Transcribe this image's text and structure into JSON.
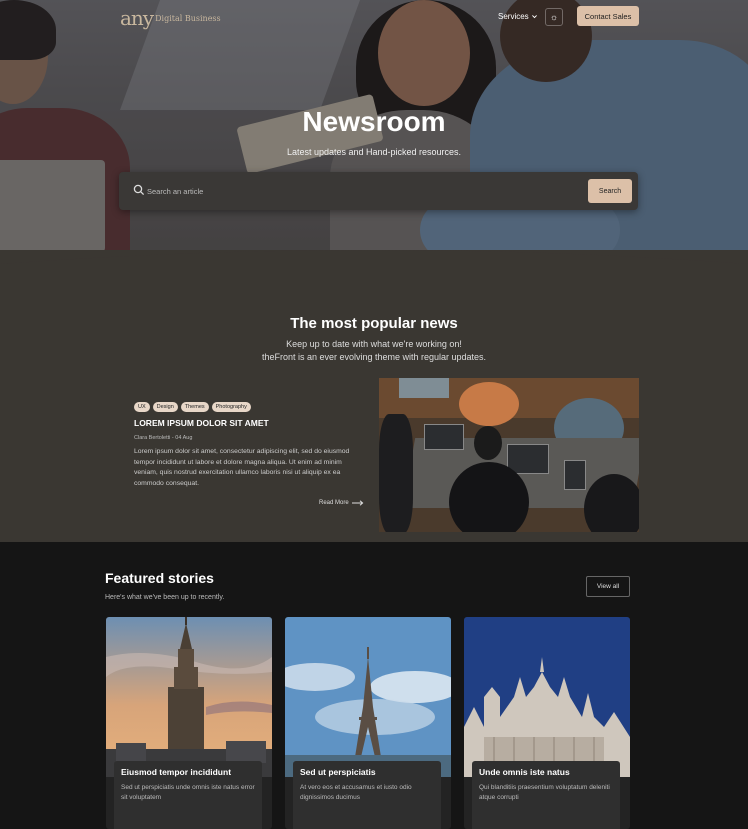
{
  "nav": {
    "logo_main": "any",
    "logo_sub": "Digital Business",
    "services_label": "Services",
    "contact_label": "Contact Sales"
  },
  "hero": {
    "title": "Newsroom",
    "subtitle": "Latest updates and Hand-picked resources.",
    "search_placeholder": "Search an article",
    "search_button": "Search"
  },
  "popular": {
    "title": "The most popular news",
    "subtitle_line1": "Keep up to date with what we're working on!",
    "subtitle_line2": "theFront is an ever evolving theme with regular updates.",
    "card": {
      "tags": [
        "UX",
        "Design",
        "Themes",
        "Photography"
      ],
      "title": "LOREM IPSUM DOLOR SIT AMET",
      "meta": "Clara Bertoletti - 04 Aug",
      "body": "Lorem ipsum dolor sit amet, consectetur adipiscing elit, sed do eiusmod tempor incididunt ut labore et dolore magna aliqua. Ut enim ad minim veniam, quis nostrud exercitation ullamco laboris nisi ut aliquip ex ea commodo consequat.",
      "read_more": "Read More"
    }
  },
  "featured": {
    "title": "Featured stories",
    "subtitle": "Here's what we've been up to recently.",
    "view_all": "View all",
    "stories": [
      {
        "title": "Eiusmod tempor incididunt",
        "text": "Sed ut perspiciatis unde omnis iste natus error sit voluptatem"
      },
      {
        "title": "Sed ut perspiciatis",
        "text": "At vero eos et accusamus et iusto odio dignissimos ducimus"
      },
      {
        "title": "Unde omnis iste natus",
        "text": "Qui blanditiis praesentium voluptatum deleniti atque corrupti"
      }
    ]
  },
  "colors": {
    "accent": "#dcc0a8",
    "popular_bg": "#3a3732",
    "featured_bg": "#151515"
  }
}
